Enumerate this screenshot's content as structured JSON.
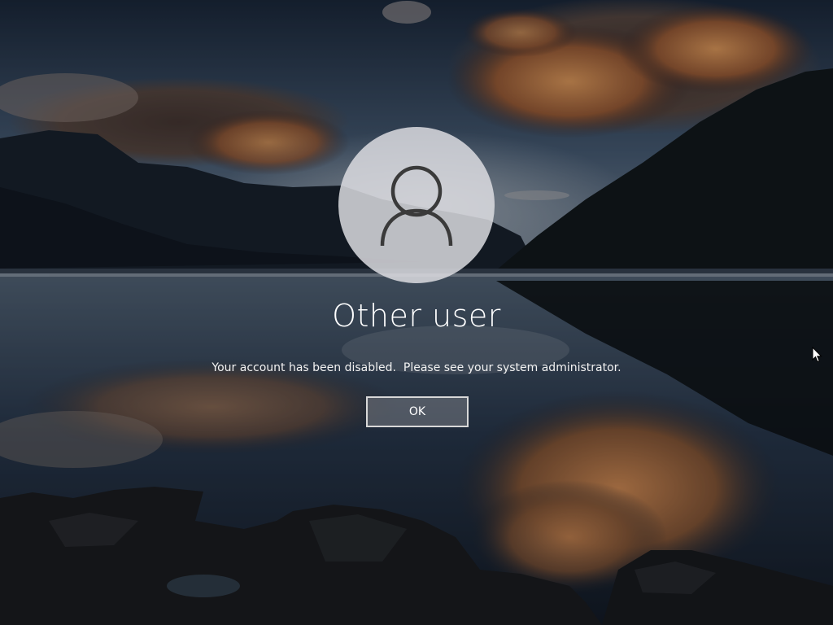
{
  "screen": {
    "type": "windows-lock-screen",
    "background": "lake-mountains-sunset"
  },
  "account": {
    "avatar_icon": "user-silhouette-icon",
    "username": "Other user",
    "message": "Your account has been disabled.  Please see your system administrator."
  },
  "dialog": {
    "ok_label": "OK"
  },
  "colors": {
    "text": "#ffffff",
    "button_border": "#d8d8d8",
    "avatar_bg": "#dedee2",
    "avatar_icon": "#3a3a3a"
  },
  "pointer": {
    "icon": "mouse-pointer-icon"
  }
}
